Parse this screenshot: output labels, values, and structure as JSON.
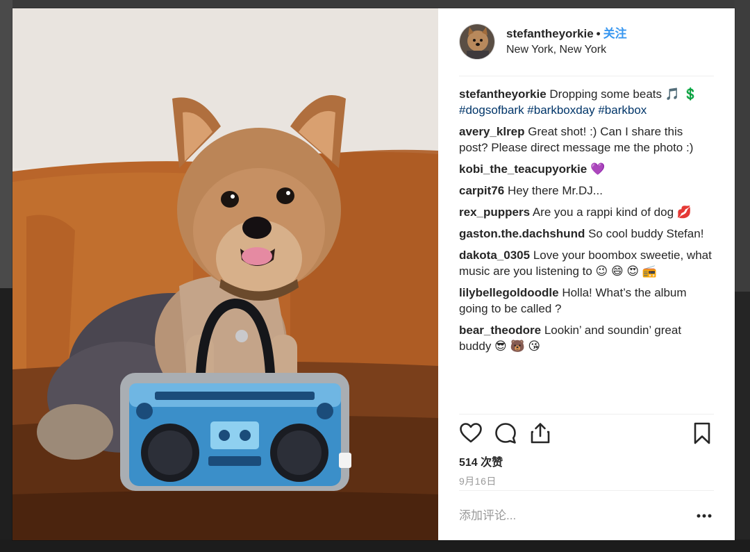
{
  "post": {
    "username": "stefantheyorkie",
    "separator": "•",
    "follow_label": "关注",
    "location": "New York, New York",
    "likes": "514 次赞",
    "date": "9月16日"
  },
  "caption": {
    "author": "stefantheyorkie",
    "text": "Dropping some beats 🎵 💲 ",
    "hashtags": "#dogsofbark #barkboxday #barkbox"
  },
  "comments": [
    {
      "author": "avery_klrep",
      "text": "Great shot! :) Can I share this post? Please direct message me the photo :)"
    },
    {
      "author": "kobi_the_teacupyorkie",
      "text": "💜"
    },
    {
      "author": "carpit76",
      "text": "Hey there Mr.DJ..."
    },
    {
      "author": "rex_puppers",
      "text": "Are you a rappi kind of dog 💋"
    },
    {
      "author": "gaston.the.dachshund",
      "text": "So cool buddy Stefan!"
    },
    {
      "author": "dakota_0305",
      "text": "Love your boombox sweetie, what music are you listening to 😉 😄 😍 📻"
    },
    {
      "author": "lilybellegoldoodle",
      "text": "Holla! What’s the album going to be called ?"
    },
    {
      "author": "bear_theodore",
      "text": "Lookin’ and soundin’ great buddy 😎 🐻 😘"
    }
  ],
  "add_comment": {
    "placeholder": "添加评论..."
  },
  "icons": {
    "like": "heart-icon",
    "comment": "comment-bubble-icon",
    "share": "share-upload-icon",
    "save": "bookmark-icon",
    "more": "more-dots-icon"
  },
  "colors": {
    "follow": "#3897f0",
    "hashtag": "#003569",
    "muted": "#999999",
    "text": "#262626"
  }
}
